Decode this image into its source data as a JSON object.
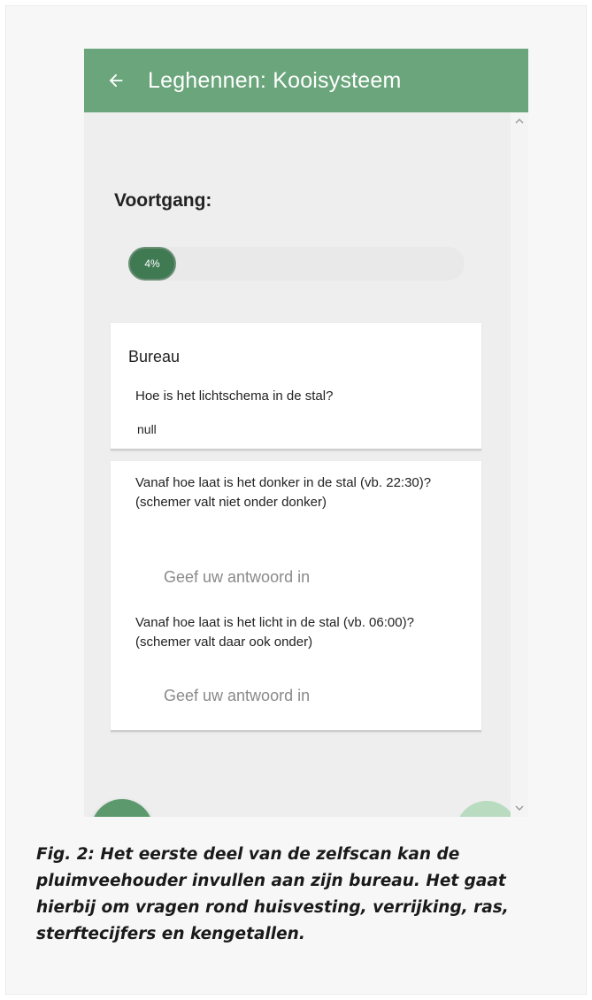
{
  "appbar": {
    "title": "Leghennen: Kooisysteem",
    "back_icon": "arrow-left-icon"
  },
  "progress": {
    "label": "Voortgang:",
    "percent_text": "4%",
    "value": 4
  },
  "cards": [
    {
      "section_title": "Bureau",
      "questions": [
        {
          "text": "Hoe is het lichtschema in de stal?",
          "answer": "null"
        }
      ]
    },
    {
      "questions": [
        {
          "text": "Vanaf hoe laat is het donker in de stal (vb. 22:30)? (schemer valt niet onder donker)",
          "placeholder": "Geef uw antwoord in"
        },
        {
          "text": "Vanaf hoe laat is het licht in de stal (vb. 06:00)? (schemer valt daar ook onder)",
          "placeholder": "Geef uw antwoord in"
        }
      ]
    }
  ],
  "nav": {
    "prev_icon": "arrow-left-icon",
    "next_icon": "arrow-right-icon"
  },
  "caption": "Fig. 2: Het eerste deel van de zelfscan kan de pluimveehouder invullen aan zijn bureau. Het gaat hierbij om vragen rond huisvesting, verrijking, ras, sterftecijfers en kengetallen.",
  "colors": {
    "appbar": "#6aa57b",
    "progress_fill": "#3f7a52",
    "fab_prev": "#5c9a6d",
    "fab_next": "#b9dcc1"
  }
}
